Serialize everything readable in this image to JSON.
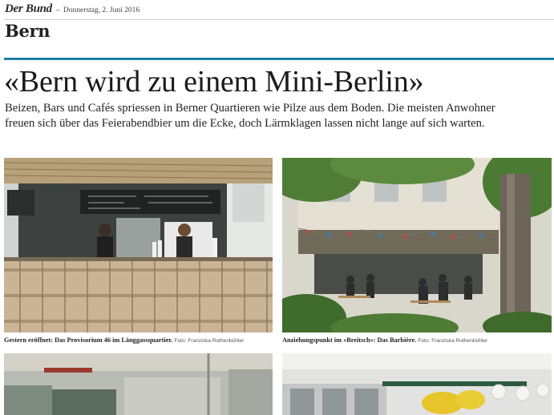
{
  "masthead": {
    "logo": "Der Bund",
    "dash": "–",
    "date": "Donnerstag, 2. Juni 2016"
  },
  "section": "Bern",
  "article": {
    "headline": "«Bern wird zu einem Mini-Berlin»",
    "lead_lines": [
      "Beizen, Bars und Cafés spriessen in Berner Quartieren wie Pilze aus dem Boden. Die meisten Anwohner",
      "freuen sich über das Feierabendbier um die Ecke, doch Lärmklagen lassen nicht lange auf sich warten."
    ]
  },
  "photos": [
    {
      "caption_bold": "Gestern eröffnet: Das Provisorium 46 im Länggassquartier.",
      "credit": "Foto: Franziska Rothenbühler"
    },
    {
      "caption_bold": "Anziehungspunkt im «Breitsch»: Das Barbière.",
      "credit": "Foto: Franziska Rothenbühler"
    }
  ],
  "colors": {
    "accent_rule": "#1d7fa3",
    "text": "#1b1b1b"
  }
}
